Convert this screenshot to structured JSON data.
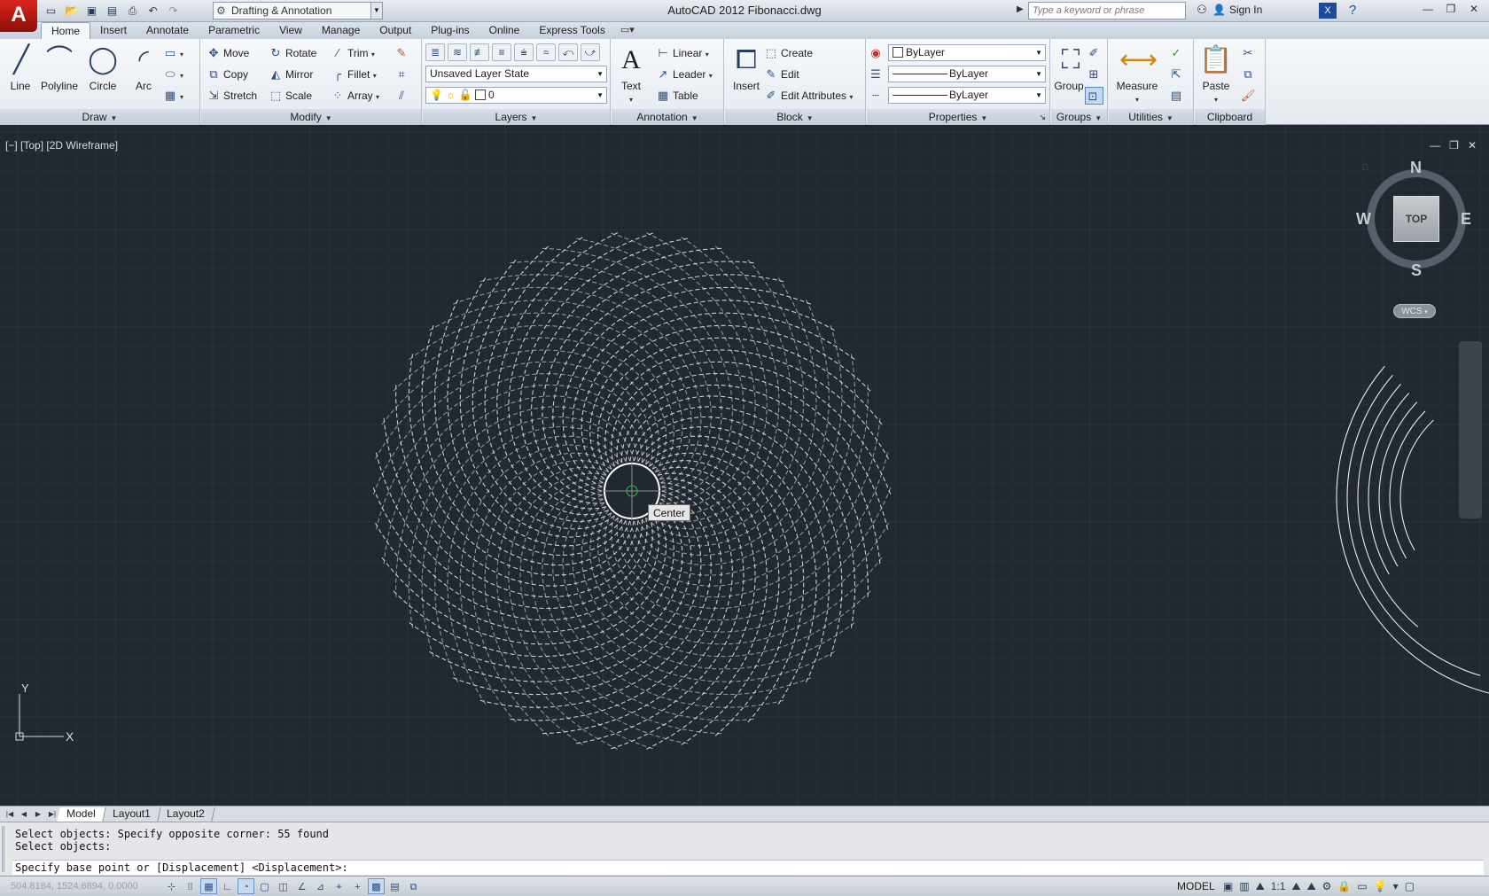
{
  "app": {
    "logo": "A",
    "title": "AutoCAD 2012   Fibonacci.dwg",
    "workspace": "Drafting & Annotation",
    "search_placeholder": "Type a keyword or phrase",
    "sign_in": "Sign In"
  },
  "qat": [
    "new-icon",
    "open-icon",
    "save-icon",
    "saveas-icon",
    "plot-icon",
    "undo-icon",
    "redo-icon"
  ],
  "tabs": [
    "Home",
    "Insert",
    "Annotate",
    "Parametric",
    "View",
    "Manage",
    "Output",
    "Plug-ins",
    "Online",
    "Express Tools"
  ],
  "active_tab": "Home",
  "ribbon": {
    "draw": {
      "title": "Draw",
      "big": [
        "Line",
        "Polyline",
        "Circle",
        "Arc"
      ]
    },
    "modify": {
      "title": "Modify",
      "items": [
        "Move",
        "Rotate",
        "Trim",
        "Copy",
        "Mirror",
        "Fillet",
        "Stretch",
        "Scale",
        "Array"
      ]
    },
    "layers": {
      "title": "Layers",
      "layer_state": "Unsaved Layer State",
      "current_layer": "0"
    },
    "annotation": {
      "title": "Annotation",
      "big": "Text",
      "items": [
        "Linear",
        "Leader",
        "Table"
      ]
    },
    "block": {
      "title": "Block",
      "big": "Insert",
      "items": [
        "Create",
        "Edit",
        "Edit Attributes"
      ]
    },
    "properties": {
      "title": "Properties",
      "color": "ByLayer",
      "lineweight": "ByLayer",
      "linetype": "ByLayer"
    },
    "groups": {
      "title": "Groups",
      "big": "Group"
    },
    "utilities": {
      "title": "Utilities",
      "big": "Measure"
    },
    "clipboard": {
      "title": "Clipboard",
      "big": "Paste"
    }
  },
  "viewport": {
    "label": "[−] [Top] [2D Wireframe]",
    "tooltip": "Center",
    "viewcube": {
      "top": "TOP",
      "n": "N",
      "s": "S",
      "e": "E",
      "w": "W",
      "wcs": "WCS"
    },
    "ucs": {
      "x": "X",
      "y": "Y"
    }
  },
  "layout_tabs": [
    "Model",
    "Layout1",
    "Layout2"
  ],
  "active_layout": "Model",
  "command": {
    "lines": [
      "Select objects: Specify opposite corner: 55 found",
      "Select objects:"
    ],
    "prompt": "Specify base point or [Displacement] <Displacement>:"
  },
  "status": {
    "coords": "504.8184, 1524.6894, 0.0000",
    "model": "MODEL",
    "scale": "1:1"
  },
  "colors": {
    "canvas": "#212830",
    "app_red": "#c61d16",
    "ribbon": "#eef1f5"
  }
}
